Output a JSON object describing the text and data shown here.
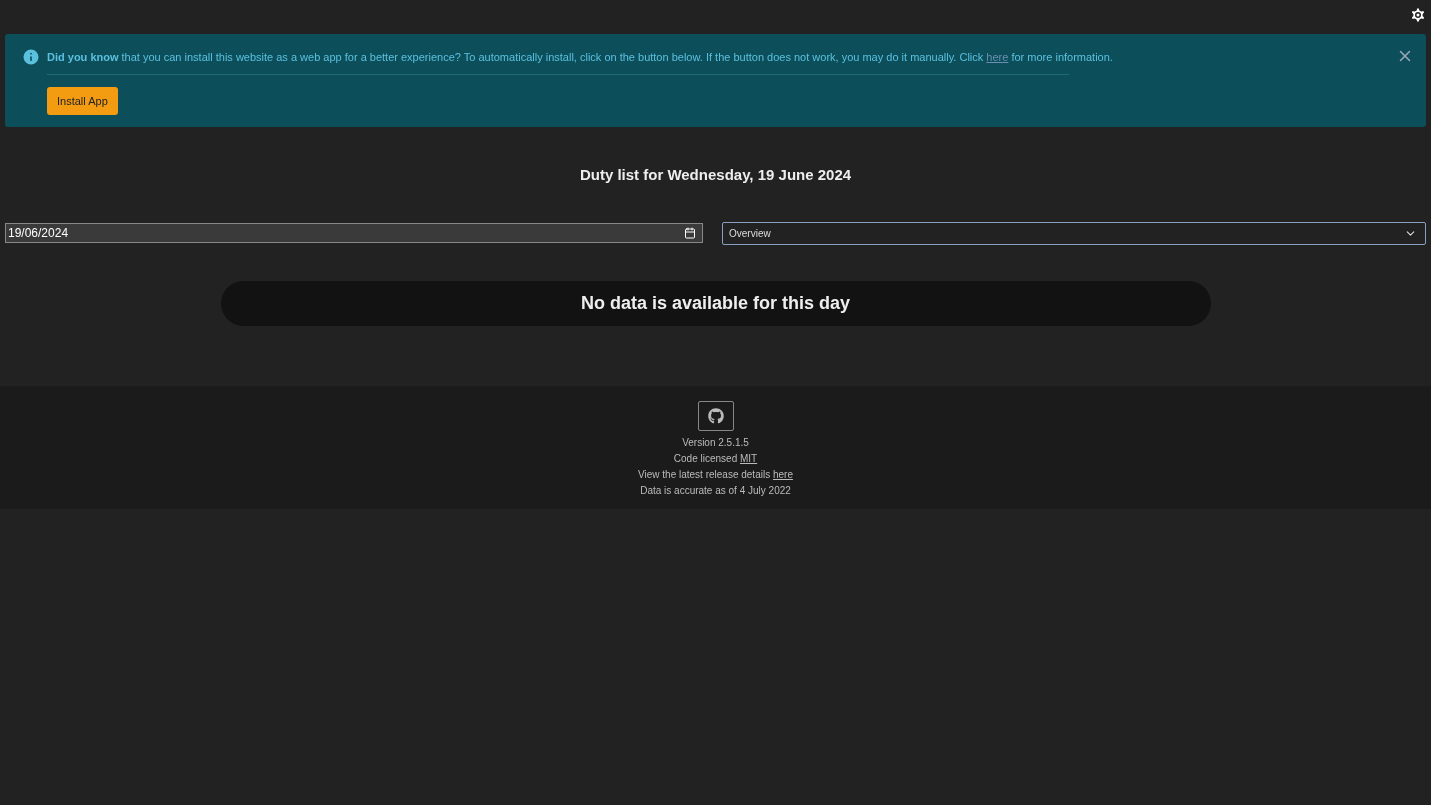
{
  "alert": {
    "text": "**Did you know** that you can install this website as a web app for a better experience? To automatically install, click on the button below. If the button does not work, you may do it manually. Click ",
    "link": "here",
    "text_after": " for more information.",
    "button": "Install App"
  },
  "heading": "Duty list for Wednesday, 19 June 2024",
  "date_field": {
    "value": "19/06/2024"
  },
  "view_select": {
    "value": "Overview"
  },
  "empty_message": "No data is available for this day",
  "footer": {
    "lines": [
      {
        "text": "Version 2.5.1.5"
      },
      {
        "text": "Code licensed ",
        "link": "MIT"
      },
      {
        "text": "View the latest release details ",
        "link": "here"
      },
      {
        "text": "Data is accurate as of 4 July 2022"
      }
    ]
  }
}
